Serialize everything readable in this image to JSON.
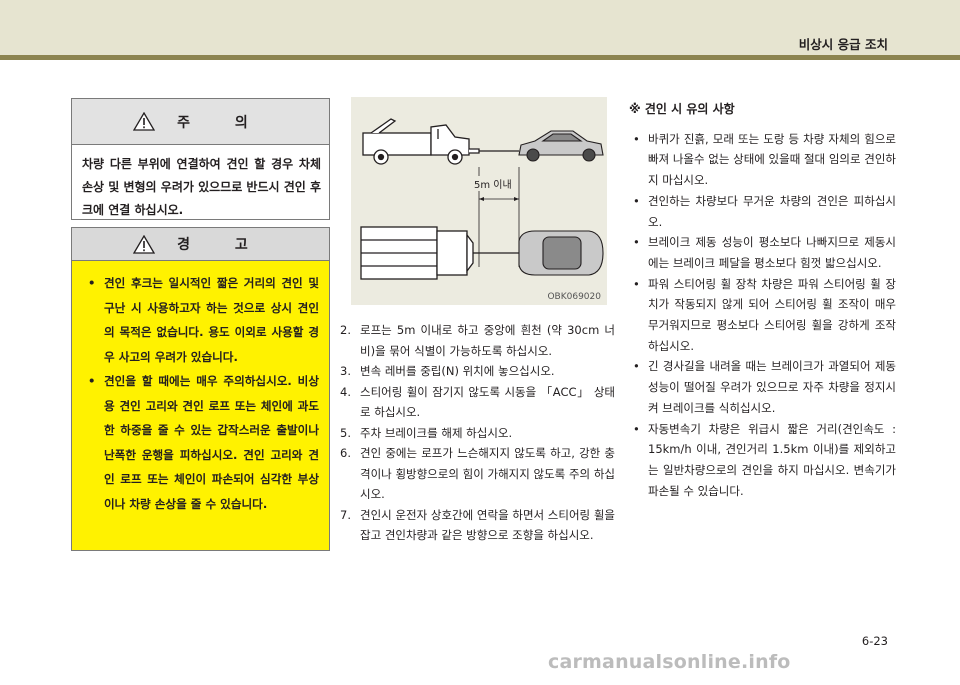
{
  "header": {
    "section_title": "비상시 응급 조치"
  },
  "caution": {
    "title": "주 의",
    "text": "차량 다른 부위에 연결하여 견인 할 경우 차체 손상 및 변형의 우려가 있으므로 반드시 견인 후크에 연결 하십시오."
  },
  "warning": {
    "title": "경 고",
    "items": [
      "견인 후크는 일시적인 짧은 거리의 견인 및 구난 시 사용하고자 하는 것으로 상시 견인의 목적은 없습니다. 용도 이외로 사용할 경우 사고의 우려가 있습니다.",
      "견인을 할 때에는 매우 주의하십시오. 비상용 견인 고리와 견인 로프 또는 체인에 과도한 하중을 줄 수 있는 갑작스러운 출발이나 난폭한 운행을 피하십시오. 견인 고리와 견인 로프 또는 체인이 파손되어 심각한 부상이나 차량 손상을 줄 수 있습니다."
    ]
  },
  "figure": {
    "distance_label": "5m 이내",
    "code": "OBK069020"
  },
  "steps": [
    {
      "num": "2.",
      "text": "로프는 5m 이내로 하고 중앙에 흰천 (약 30cm 너비)을 묶어 식별이 가능하도록 하십시오."
    },
    {
      "num": "3.",
      "text": "변속 레버를 중립(N) 위치에 놓으십시오."
    },
    {
      "num": "4.",
      "text": "스티어링 휠이 잠기지 않도록 시동을 「ACC」 상태로 하십시오."
    },
    {
      "num": "5.",
      "text": "주차 브레이크를 해제 하십시오."
    },
    {
      "num": "6.",
      "text": "견인 중에는 로프가 느슨해지지 않도록 하고, 강한 충격이나 횡방향으로의 힘이 가해지지 않도록 주의 하십시오."
    },
    {
      "num": "7.",
      "text": "견인시 운전자 상호간에 연락을 하면서 스티어링 휠을 잡고 견인차량과 같은 방향으로 조향을 하십시오."
    }
  ],
  "notes": {
    "title": "※ 견인 시 유의 사항",
    "items": [
      "바퀴가 진흙, 모래 또는 도랑 등 차량 자체의 힘으로 빠져 나올수 없는 상태에 있을때 절대 임의로 견인하지 마십시오.",
      "견인하는 차량보다 무거운 차량의 견인은 피하십시오.",
      "브레이크 제동 성능이 평소보다 나빠지므로 제동시에는 브레이크 페달을 평소보다 힘껏 밟으십시오.",
      "파워 스티어링 휠 장착 차량은 파워 스티어링 휠 장치가 작동되지 않게 되어 스티어링 휠 조작이 매우 무거워지므로 평소보다 스티어링 휠을 강하게 조작하십시오.",
      "긴 경사길을 내려올 때는 브레이크가 과열되어 제동 성능이 떨어질 우려가 있으므로 자주 차량을 정지시켜 브레이크를 식히십시오.",
      "자동변속기 차량은 위급시 짧은 거리(견인속도 : 15km/h 이내, 견인거리 1.5km 이내)를 제외하고는 일반차량으로의 견인을 하지 마십시오. 변속기가 파손될 수 있습니다."
    ]
  },
  "footer": {
    "page_number": "6-23",
    "watermark": "carmanualsonline.info"
  }
}
